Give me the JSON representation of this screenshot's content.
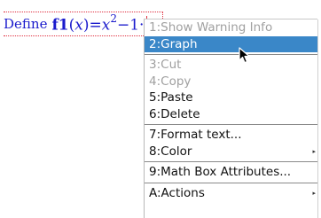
{
  "editor": {
    "keyword": "Define",
    "function_name": "f1",
    "open_paren": "(",
    "variable": "x",
    "close_paren": ")",
    "equals": "=",
    "term1_var": "x",
    "term1_exp": "2",
    "minus": "−1·",
    "term2_var": "x"
  },
  "context_menu": {
    "items": [
      {
        "label": "1:Show Warning Info",
        "state": "disabled"
      },
      {
        "label": "2:Graph",
        "state": "highlighted"
      },
      {
        "label": "3:Cut",
        "state": "disabled"
      },
      {
        "label": "4:Copy",
        "state": "disabled"
      },
      {
        "label": "5:Paste",
        "state": "enabled"
      },
      {
        "label": "6:Delete",
        "state": "enabled"
      },
      {
        "label": "7:Format text...",
        "state": "enabled"
      },
      {
        "label": "8:Color",
        "state": "enabled",
        "submenu": true
      },
      {
        "label": "9:Math Box Attributes...",
        "state": "enabled"
      },
      {
        "label": "A:Actions",
        "state": "enabled",
        "submenu": true
      }
    ],
    "submenu_arrow": "▸"
  },
  "colors": {
    "math_text": "#1a1acc",
    "highlight": "#3a87c8",
    "disabled_text": "#a0a0a0",
    "box_border": "#e03040"
  },
  "icons": {
    "pointer": "mouse-pointer-icon"
  }
}
